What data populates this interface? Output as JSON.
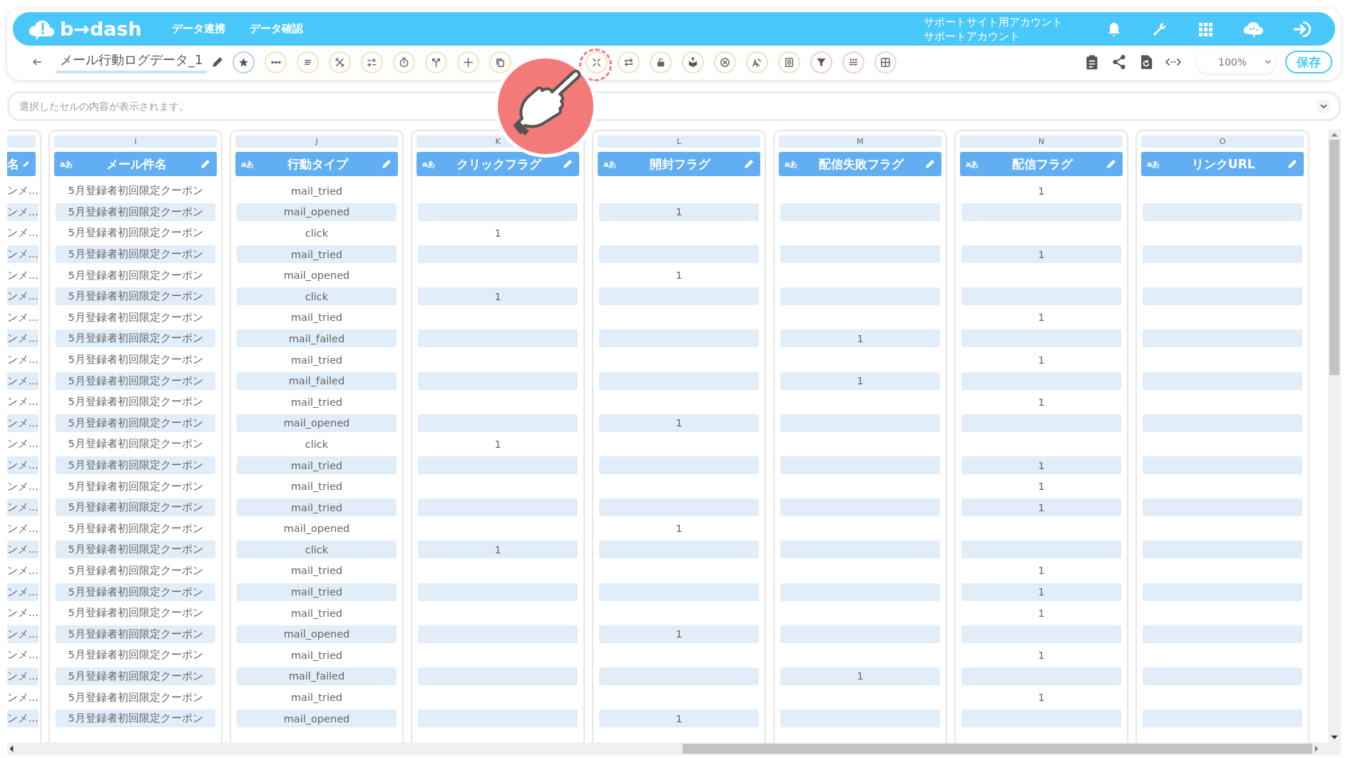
{
  "header": {
    "logo": "b→dash",
    "nav": [
      "データ連携",
      "データ確認"
    ],
    "account": [
      "サポートサイト用アカウント",
      "サポートアカウント"
    ]
  },
  "toolbar": {
    "title": "メール行動ログデータ_1",
    "zoom": "100%",
    "save": "保存"
  },
  "cell_preview": {
    "placeholder": "選択したセルの内容が表示されます。"
  },
  "table": {
    "columns": [
      {
        "name": "名"
      },
      {
        "letter": "I",
        "badge": "aあ",
        "name": "メール件名"
      },
      {
        "letter": "J",
        "badge": "aあ",
        "name": "行動タイプ"
      },
      {
        "letter": "K",
        "badge": "aあ",
        "name": "クリックフラグ"
      },
      {
        "letter": "L",
        "badge": "aあ",
        "name": "開封フラグ"
      },
      {
        "letter": "M",
        "badge": "aあ",
        "name": "配信失敗フラグ"
      },
      {
        "letter": "N",
        "badge": "aあ",
        "name": "配信フラグ"
      },
      {
        "letter": "O",
        "badge": "aあ",
        "name": "リンクURL"
      }
    ],
    "rows": [
      [
        "ンメ...",
        "5月登録者初回限定クーポン",
        "mail_tried",
        null,
        null,
        null,
        "1",
        null
      ],
      [
        "ンメ...",
        "5月登録者初回限定クーポン",
        "mail_opened",
        null,
        "1",
        null,
        null,
        null
      ],
      [
        "ンメ...",
        "5月登録者初回限定クーポン",
        "click",
        "1",
        null,
        null,
        null,
        null
      ],
      [
        "ンメ...",
        "5月登録者初回限定クーポン",
        "mail_tried",
        null,
        null,
        null,
        "1",
        null
      ],
      [
        "ンメ...",
        "5月登録者初回限定クーポン",
        "mail_opened",
        null,
        "1",
        null,
        null,
        null
      ],
      [
        "ンメ...",
        "5月登録者初回限定クーポン",
        "click",
        "1",
        null,
        null,
        null,
        null
      ],
      [
        "ンメ...",
        "5月登録者初回限定クーポン",
        "mail_tried",
        null,
        null,
        null,
        "1",
        null
      ],
      [
        "ンメ...",
        "5月登録者初回限定クーポン",
        "mail_failed",
        null,
        null,
        "1",
        null,
        null
      ],
      [
        "ンメ...",
        "5月登録者初回限定クーポン",
        "mail_tried",
        null,
        null,
        null,
        "1",
        null
      ],
      [
        "ンメ...",
        "5月登録者初回限定クーポン",
        "mail_failed",
        null,
        null,
        "1",
        null,
        null
      ],
      [
        "ンメ...",
        "5月登録者初回限定クーポン",
        "mail_tried",
        null,
        null,
        null,
        "1",
        null
      ],
      [
        "ンメ...",
        "5月登録者初回限定クーポン",
        "mail_opened",
        null,
        "1",
        null,
        null,
        null
      ],
      [
        "ンメ...",
        "5月登録者初回限定クーポン",
        "click",
        "1",
        null,
        null,
        null,
        null
      ],
      [
        "ンメ...",
        "5月登録者初回限定クーポン",
        "mail_tried",
        null,
        null,
        null,
        "1",
        null
      ],
      [
        "ンメ...",
        "5月登録者初回限定クーポン",
        "mail_tried",
        null,
        null,
        null,
        "1",
        null
      ],
      [
        "ンメ...",
        "5月登録者初回限定クーポン",
        "mail_tried",
        null,
        null,
        null,
        "1",
        null
      ],
      [
        "ンメ...",
        "5月登録者初回限定クーポン",
        "mail_opened",
        null,
        "1",
        null,
        null,
        null
      ],
      [
        "ンメ...",
        "5月登録者初回限定クーポン",
        "click",
        "1",
        null,
        null,
        null,
        null
      ],
      [
        "ンメ...",
        "5月登録者初回限定クーポン",
        "mail_tried",
        null,
        null,
        null,
        "1",
        null
      ],
      [
        "ンメ...",
        "5月登録者初回限定クーポン",
        "mail_tried",
        null,
        null,
        null,
        "1",
        null
      ],
      [
        "ンメ...",
        "5月登録者初回限定クーポン",
        "mail_tried",
        null,
        null,
        null,
        "1",
        null
      ],
      [
        "ンメ...",
        "5月登録者初回限定クーポン",
        "mail_opened",
        null,
        "1",
        null,
        null,
        null
      ],
      [
        "ンメ...",
        "5月登録者初回限定クーポン",
        "mail_tried",
        null,
        null,
        null,
        "1",
        null
      ],
      [
        "ンメ...",
        "5月登録者初回限定クーポン",
        "mail_failed",
        null,
        null,
        "1",
        null,
        null
      ],
      [
        "ンメ...",
        "5月登録者初回限定クーポン",
        "mail_tried",
        null,
        null,
        null,
        "1",
        null
      ],
      [
        "ンメ...",
        "5月登録者初回限定クーポン",
        "mail_opened",
        null,
        "1",
        null,
        null,
        null
      ]
    ]
  }
}
